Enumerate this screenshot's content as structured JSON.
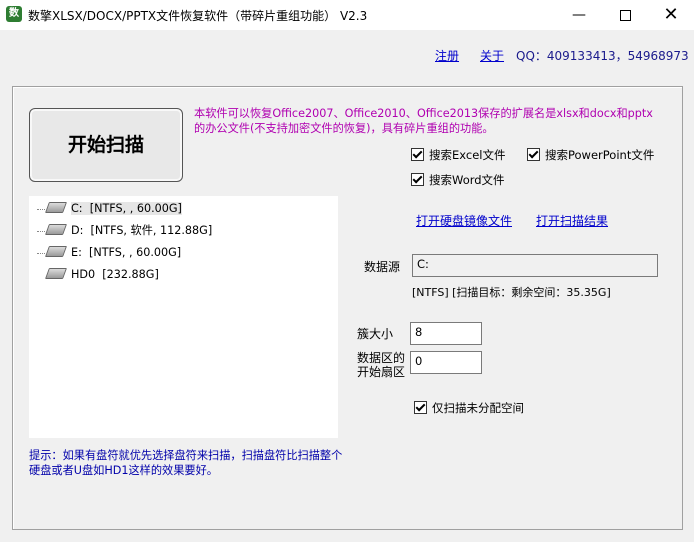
{
  "window": {
    "icon_text": "数",
    "title": "数擎XLSX/DOCX/PPTX文件恢复软件（带碎片重组功能） V2.3",
    "minimize": "—",
    "close": "✕"
  },
  "header": {
    "register": "注册",
    "about": "关于",
    "qq": "QQ：409133413，54968973"
  },
  "scan_button": "开始扫描",
  "description": "本软件可以恢复Office2007、Office2010、Office2013保存的扩展名是xlsx和docx和pptx的办公文件(不支持加密文件的恢复)，具有碎片重组的功能。",
  "checkboxes": {
    "excel": "搜索Excel文件",
    "powerpoint": "搜索PowerPoint文件",
    "word": "搜索Word文件"
  },
  "drives": [
    {
      "name": "C:",
      "info": "[NTFS, , 60.00G]"
    },
    {
      "name": "D:",
      "info": "[NTFS, 软件, 112.88G]"
    },
    {
      "name": "E:",
      "info": "[NTFS, , 60.00G]"
    },
    {
      "name": "HD0",
      "info": "[232.88G]"
    }
  ],
  "links": {
    "open_image": "打开硬盘镜像文件",
    "open_result": "打开扫描结果"
  },
  "source": {
    "label": "数据源",
    "value": "C:",
    "status": "[NTFS]  [扫描目标：剩余空间：35.35G]"
  },
  "cluster": {
    "label": "簇大小",
    "value": "8"
  },
  "start_sector": {
    "label_line1": "数据区的",
    "label_line2": "开始扇区",
    "value": "0"
  },
  "unallocated": "仅扫描未分配空间",
  "hint": "提示：如果有盘符就优先选择盘符来扫描，扫描盘符比扫描整个硬盘或者U盘如HD1这样的效果要好。"
}
